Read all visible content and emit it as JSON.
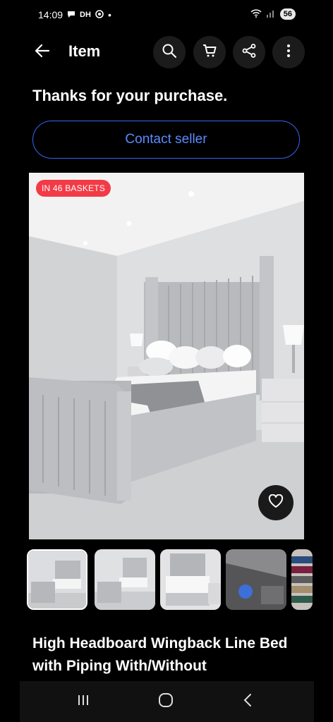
{
  "status_bar": {
    "time": "14:09",
    "indicators": "DH",
    "dot": "•",
    "battery": "56"
  },
  "header": {
    "title": "Item",
    "icons": [
      "back-arrow-icon",
      "search-icon",
      "cart-icon",
      "share-icon",
      "more-vertical-icon"
    ]
  },
  "main": {
    "thanks_text": "Thanks for your purchase.",
    "contact_label": "Contact seller",
    "badge_text": "IN 46 BASKETS",
    "title_text": "High Headboard Wingback Line Bed with Piping With/Without"
  },
  "colors": {
    "accent_blue": "#3665f3",
    "badge_red": "#f23b47"
  }
}
